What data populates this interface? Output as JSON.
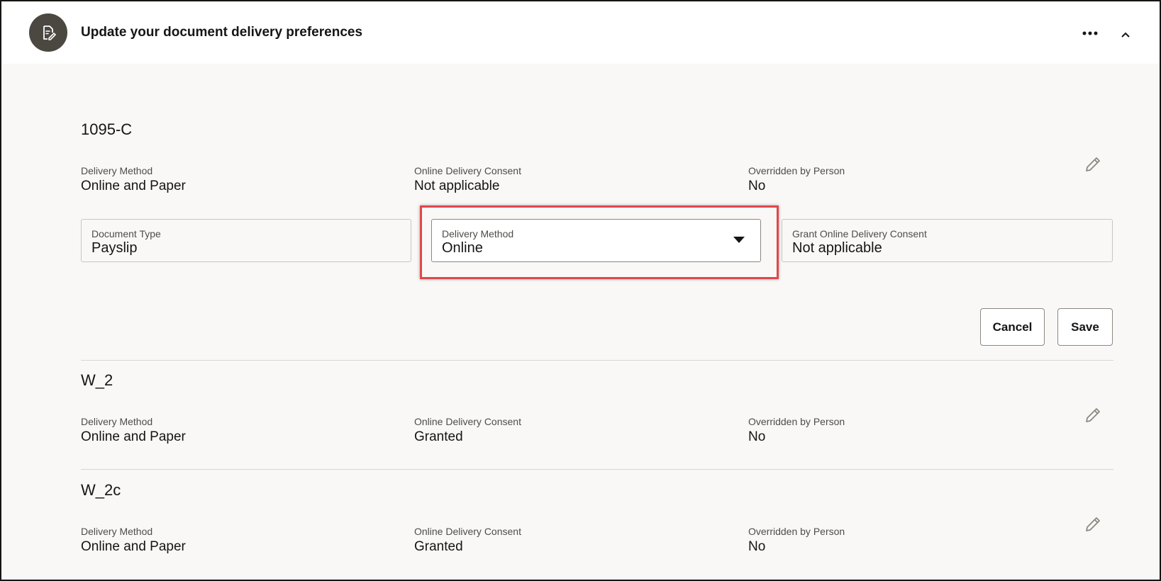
{
  "header": {
    "title": "Update your document delivery preferences",
    "icon": "document-edit-icon",
    "more_icon": "ellipsis-icon",
    "collapse_icon": "chevron-up-icon"
  },
  "sections": [
    {
      "title": "1095-C",
      "fields": [
        {
          "label": "Delivery Method",
          "value": "Online and Paper"
        },
        {
          "label": "Online Delivery Consent",
          "value": "Not applicable"
        },
        {
          "label": "Overridden by Person",
          "value": "No"
        }
      ],
      "edit_icon": "pencil-icon"
    },
    {
      "title": "W_2",
      "fields": [
        {
          "label": "Delivery Method",
          "value": "Online and Paper"
        },
        {
          "label": "Online Delivery Consent",
          "value": "Granted"
        },
        {
          "label": "Overridden by Person",
          "value": "No"
        }
      ],
      "edit_icon": "pencil-icon"
    },
    {
      "title": "W_2c",
      "fields": [
        {
          "label": "Delivery Method",
          "value": "Online and Paper"
        },
        {
          "label": "Online Delivery Consent",
          "value": "Granted"
        },
        {
          "label": "Overridden by Person",
          "value": "No"
        }
      ],
      "edit_icon": "pencil-icon"
    }
  ],
  "form": {
    "document_type": {
      "label": "Document Type",
      "value": "Payslip"
    },
    "delivery_method": {
      "label": "Delivery Method",
      "value": "Online"
    },
    "grant_consent": {
      "label": "Grant Online Delivery Consent",
      "value": "Not applicable"
    },
    "cancel_label": "Cancel",
    "save_label": "Save"
  },
  "colors": {
    "highlight": "#e0474c",
    "avatar_bg": "#4b4842",
    "panel_bg": "#f9f8f6"
  }
}
